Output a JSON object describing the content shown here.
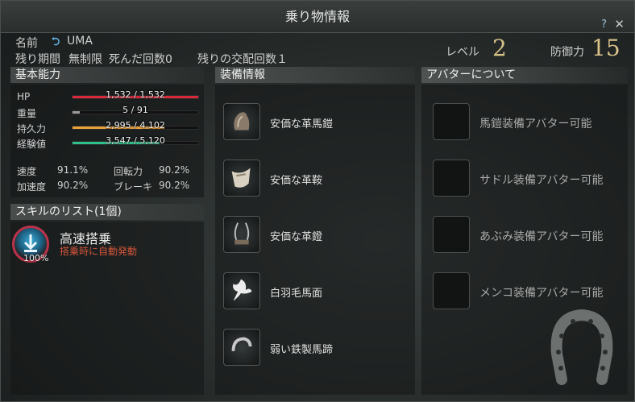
{
  "window": {
    "title": "乗り物情報",
    "help": "?",
    "close": "✕"
  },
  "mount": {
    "name_label": "名前",
    "name": "UMA",
    "period_label": "残り期間",
    "period": "無制限",
    "deaths_label": "死んだ回数0",
    "breeding_label": "残りの交配回数１",
    "level_label": "レベル",
    "level": "2",
    "defense_label": "防御力",
    "defense": "15"
  },
  "basic": {
    "header": "基本能力",
    "bars": [
      {
        "label": "HP",
        "text": "1,532 / 1,532",
        "fraction": 1.0,
        "color": "#d8283a"
      },
      {
        "label": "重量",
        "text": "5 / 91",
        "fraction": 0.055,
        "color": "#9a9a9a"
      },
      {
        "label": "持久力",
        "text": "2,995 / 4,102",
        "fraction": 0.73,
        "color": "#e8a23a"
      },
      {
        "label": "経験値",
        "text": "3,547 / 5,120",
        "fraction": 0.69,
        "color": "#2fbf8a"
      }
    ],
    "stats": [
      {
        "label": "速度",
        "value": "91.1%"
      },
      {
        "label": "回転力",
        "value": "90.2%"
      },
      {
        "label": "加速度",
        "value": "90.2%"
      },
      {
        "label": "ブレーキ",
        "value": "90.2%"
      }
    ]
  },
  "skills": {
    "header": "スキルのリスト(1個)",
    "items": [
      {
        "name": "高速搭乗",
        "desc": "搭乗時に自動発動",
        "percent": "100%"
      }
    ]
  },
  "equipment": {
    "header": "装備情報",
    "items": [
      {
        "name": "安価な革馬鎧",
        "icon": "armor-icon"
      },
      {
        "name": "安価な革鞍",
        "icon": "saddle-icon"
      },
      {
        "name": "安価な革鐙",
        "icon": "stirrup-icon"
      },
      {
        "name": "白羽毛馬面",
        "icon": "feather-icon"
      },
      {
        "name": "弱い鉄製馬蹄",
        "icon": "horseshoe-icon"
      }
    ]
  },
  "avatar": {
    "header": "アバターについて",
    "items": [
      {
        "name": "馬鎧装備アバター可能"
      },
      {
        "name": "サドル装備アバター可能"
      },
      {
        "name": "あぶみ装備アバター可能"
      },
      {
        "name": "メンコ装備アバター可能"
      }
    ]
  }
}
